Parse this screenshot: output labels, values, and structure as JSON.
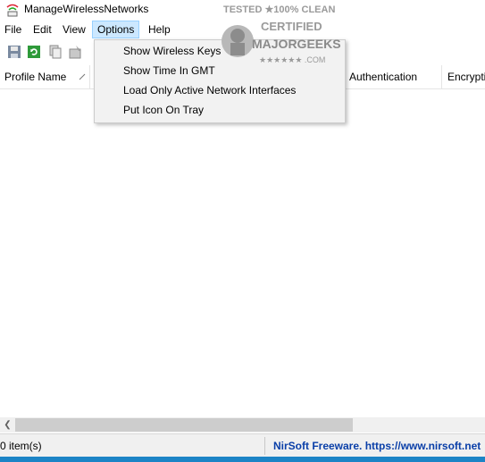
{
  "window": {
    "title": "ManageWirelessNetworks"
  },
  "menu": {
    "file": "File",
    "edit": "Edit",
    "view": "View",
    "options": "Options",
    "help": "Help"
  },
  "options_menu": {
    "items": [
      "Show Wireless Keys",
      "Show Time In GMT",
      "Load Only Active Network Interfaces",
      "Put Icon On Tray"
    ]
  },
  "columns": {
    "profile_name": "Profile Name",
    "authentication": "Authentication",
    "encryption": "Encryptio"
  },
  "status": {
    "count": "0 item(s)",
    "credit": "NirSoft Freeware. https://www.nirsoft.net"
  },
  "watermark": {
    "line1": "TESTED ★100% CLEAN",
    "line2": "CERTIFIED",
    "line3": "MAJORGEEKS",
    "line4": "★★★★★★ .COM"
  },
  "colors": {
    "menu_highlight": "#cce8ff",
    "link_blue": "#0a3fa8",
    "bottom_bar": "#1c84c6"
  }
}
